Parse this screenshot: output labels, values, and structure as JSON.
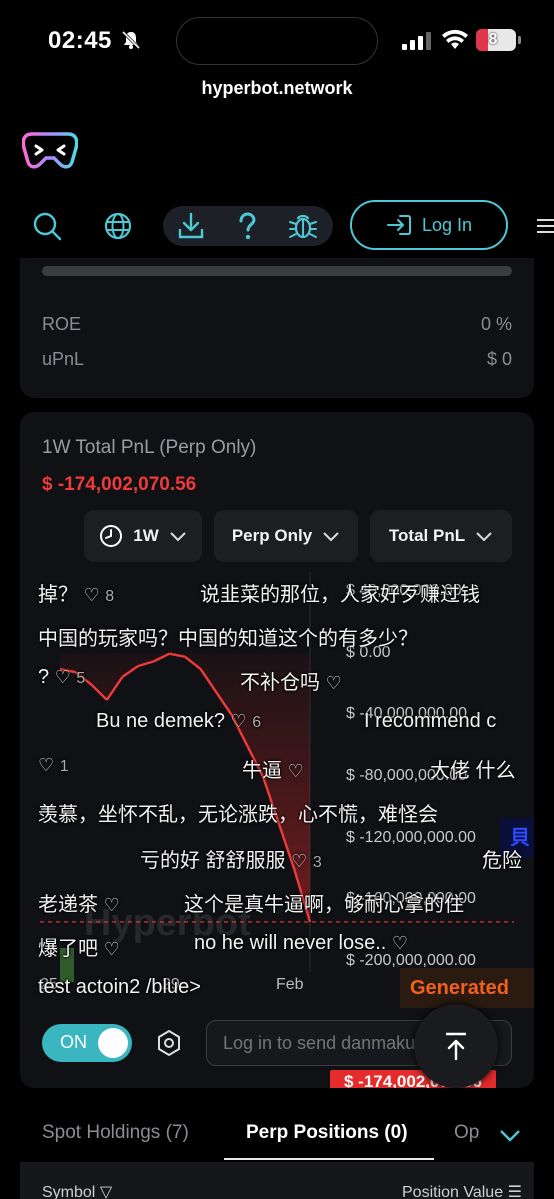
{
  "status_bar": {
    "time": "02:45",
    "battery": "8"
  },
  "browser": {
    "url": "hyperbot.network"
  },
  "header": {
    "login_label": "Log In"
  },
  "account_card": {
    "rows": [
      {
        "label": "ROE",
        "value": "0 %"
      },
      {
        "label": "uPnL",
        "value": "$ 0"
      }
    ]
  },
  "pnl_card": {
    "title": "1W Total PnL (Perp Only)",
    "total_value": "$ -174,002,070.56",
    "selectors": [
      {
        "label": "1W",
        "icon": "clock-icon"
      },
      {
        "label": "Perp Only"
      },
      {
        "label": "Total PnL"
      }
    ],
    "watermark": "Hyperbot",
    "price_tag": "$ -174,002,070.56",
    "danmaku": [
      {
        "text": "掉？",
        "likes": "8"
      },
      {
        "text": "说韭菜的那位，人家好歹赚过钱",
        "likes": ""
      },
      {
        "text": "中国的玩家吗？中国的知道这个的有多少？",
        "likes": ""
      },
      {
        "text": "?",
        "likes": "5"
      },
      {
        "text": "不补仓吗",
        "likes": ""
      },
      {
        "text": "Bu ne demek?",
        "likes": "6"
      },
      {
        "text": "I recommend c",
        "likes": ""
      },
      {
        "text": "牛逼",
        "likes": ""
      },
      {
        "text": "大佬 什么",
        "likes": ""
      },
      {
        "text": "羡慕，坐怀不乱，无论涨跌，心不慌，难怪会",
        "likes": ""
      },
      {
        "text": "亏的好 舒舒服服",
        "likes": "3"
      },
      {
        "text": "危险",
        "likes": ""
      },
      {
        "text": "老递茶",
        "likes": ""
      },
      {
        "text": "这个是真牛逼啊，够耐心拿的住",
        "likes": ""
      },
      {
        "text": "爆了吧",
        "likes": ""
      },
      {
        "text": "no he will never lose..",
        "likes": ""
      },
      {
        "text": "test actoin2 /blue>",
        "likes": ""
      },
      {
        "text": "1",
        "likes": ""
      },
      {
        "text": "Generated",
        "likes": ""
      }
    ],
    "toggle_label": "ON",
    "danmaku_placeholder": "Log in to send danmaku"
  },
  "chart_data": {
    "type": "line",
    "title": "",
    "yticks": [
      "$ 40,000,000.00",
      "$ 0.00",
      "$ -40,000,000.00",
      "$ -80,000,000.00",
      "$ -120,000,000.00",
      "$ -160,000,000.00",
      "$ -200,000,000.00"
    ],
    "xticks": [
      "25",
      "29",
      "Feb"
    ],
    "ylim": [
      -200000000,
      40000000
    ],
    "series": [
      {
        "values": [
          -10000000,
          -12000000,
          -20000000,
          -30000000,
          -15000000,
          -8000000,
          -5000000,
          0,
          -2000000,
          -10000000,
          -25000000,
          -40000000,
          -60000000,
          -80000000,
          -110000000,
          -140000000,
          -174002070.56
        ]
      }
    ],
    "grid": false
  },
  "tabs": {
    "items": [
      "Spot Holdings (7)",
      "Perp Positions (0)",
      "Op"
    ],
    "active": 1
  },
  "table": {
    "headers": [
      "Symbol",
      "Position Value"
    ]
  },
  "colors": {
    "accent": "#4dc9d6",
    "negative": "#f03a3a",
    "positive": "#2fcf6a"
  }
}
